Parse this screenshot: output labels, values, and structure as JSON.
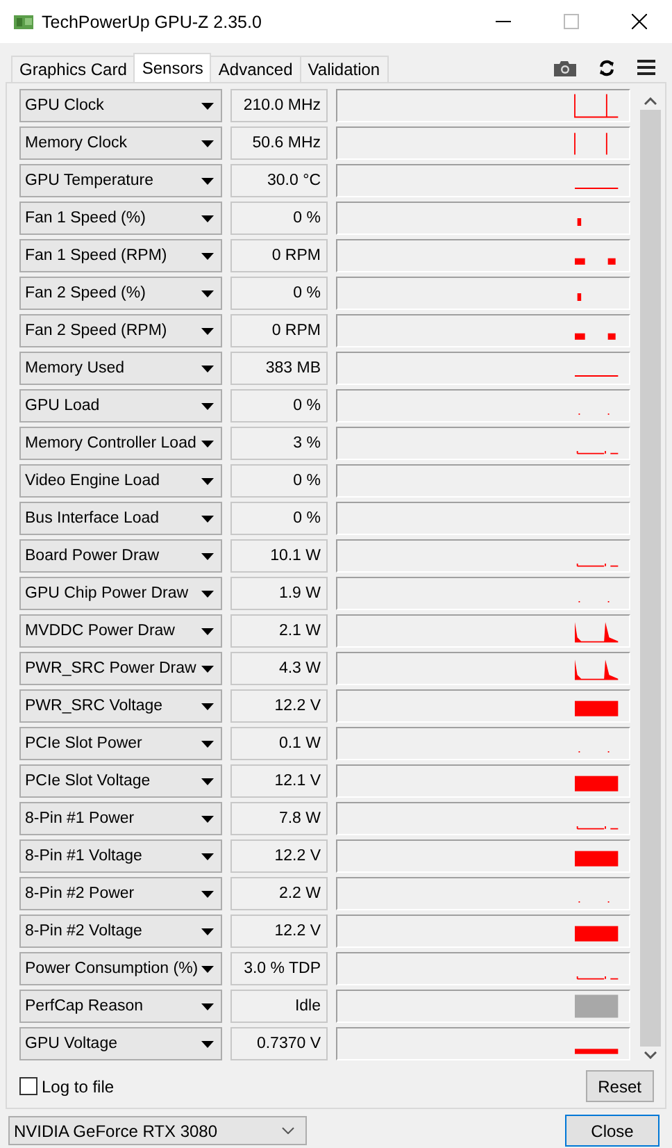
{
  "window": {
    "title": "TechPowerUp GPU-Z 2.35.0"
  },
  "tabs": [
    {
      "label": "Graphics Card",
      "selected": false
    },
    {
      "label": "Sensors",
      "selected": true
    },
    {
      "label": "Advanced",
      "selected": false
    },
    {
      "label": "Validation",
      "selected": false
    }
  ],
  "sensors": [
    {
      "name": "GPU Clock",
      "value": "210.0 MHz",
      "kind": "step"
    },
    {
      "name": "Memory Clock",
      "value": "50.6 MHz",
      "kind": "spikes"
    },
    {
      "name": "GPU Temperature",
      "value": "30.0 °C",
      "kind": "line"
    },
    {
      "name": "Fan 1 Speed (%)",
      "value": "0 %",
      "kind": "blip"
    },
    {
      "name": "Fan 1 Speed (RPM)",
      "value": "0 RPM",
      "kind": "dots"
    },
    {
      "name": "Fan 2 Speed (%)",
      "value": "0 %",
      "kind": "blip"
    },
    {
      "name": "Fan 2 Speed (RPM)",
      "value": "0 RPM",
      "kind": "dots"
    },
    {
      "name": "Memory Used",
      "value": "383 MB",
      "kind": "line"
    },
    {
      "name": "GPU Load",
      "value": "0 %",
      "kind": "dot"
    },
    {
      "name": "Memory Controller Load",
      "value": "3 %",
      "kind": "lowline"
    },
    {
      "name": "Video Engine Load",
      "value": "0 %",
      "kind": "flat"
    },
    {
      "name": "Bus Interface Load",
      "value": "0 %",
      "kind": "flat"
    },
    {
      "name": "Board Power Draw",
      "value": "10.1 W",
      "kind": "lowline"
    },
    {
      "name": "GPU Chip Power Draw",
      "value": "1.9 W",
      "kind": "dot"
    },
    {
      "name": "MVDDC Power Draw",
      "value": "2.1 W",
      "kind": "peaks"
    },
    {
      "name": "PWR_SRC Power Draw",
      "value": "4.3 W",
      "kind": "peaks"
    },
    {
      "name": "PWR_SRC Voltage",
      "value": "12.2 V",
      "kind": "block"
    },
    {
      "name": "PCIe Slot Power",
      "value": "0.1 W",
      "kind": "dot"
    },
    {
      "name": "PCIe Slot Voltage",
      "value": "12.1 V",
      "kind": "block"
    },
    {
      "name": "8-Pin #1 Power",
      "value": "7.8 W",
      "kind": "lowline"
    },
    {
      "name": "8-Pin #1 Voltage",
      "value": "12.2 V",
      "kind": "block"
    },
    {
      "name": "8-Pin #2 Power",
      "value": "2.2 W",
      "kind": "dot"
    },
    {
      "name": "8-Pin #2 Voltage",
      "value": "12.2 V",
      "kind": "block"
    },
    {
      "name": "Power Consumption (%)",
      "value": "3.0 % TDP",
      "kind": "lowline"
    },
    {
      "name": "PerfCap Reason",
      "value": "Idle",
      "kind": "gray"
    },
    {
      "name": "GPU Voltage",
      "value": "0.7370 V",
      "kind": "thickline"
    }
  ],
  "log_to_file": {
    "label": "Log to file",
    "checked": false
  },
  "reset_button": "Reset",
  "gpu_select": {
    "value": "NVIDIA GeForce RTX 3080"
  },
  "close_button": "Close"
}
